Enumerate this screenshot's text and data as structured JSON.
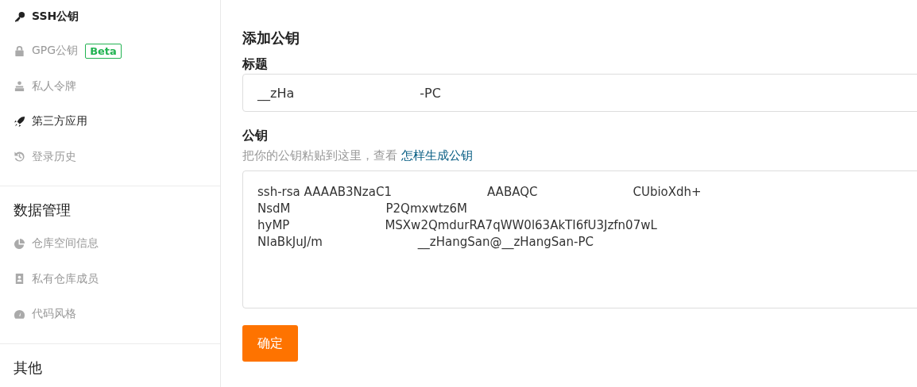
{
  "sidebar": {
    "groups": [
      {
        "items": [
          {
            "label": "SSH公钥",
            "kind": "key",
            "selected": true,
            "highlighted": false
          },
          {
            "label": "GPG公钥",
            "kind": "lock",
            "selected": false,
            "highlighted": false,
            "badge": "Beta"
          },
          {
            "label": "私人令牌",
            "kind": "token",
            "selected": false,
            "highlighted": false
          },
          {
            "label": "第三方应用",
            "kind": "rocket",
            "selected": false,
            "highlighted": true
          },
          {
            "label": "登录历史",
            "kind": "history",
            "selected": false,
            "highlighted": false
          }
        ]
      },
      {
        "heading": "数据管理",
        "items": [
          {
            "label": "仓库空间信息",
            "kind": "pie",
            "selected": false,
            "highlighted": false
          },
          {
            "label": "私有仓库成员",
            "kind": "contact",
            "selected": false,
            "highlighted": false
          },
          {
            "label": "代码风格",
            "kind": "gauge",
            "selected": false,
            "highlighted": false
          }
        ]
      },
      {
        "heading": "其他"
      }
    ]
  },
  "form": {
    "title": "添加公钥",
    "title_field": {
      "label": "标题",
      "value_parts": [
        "__zHa",
        "-PC"
      ]
    },
    "key_field": {
      "label": "公钥",
      "hint": "把你的公钥粘贴到这里，查看",
      "hint_link": "怎样生成公钥",
      "lines": [
        [
          "ssh-rsa AAAAB3NzaC1",
          "AABAQC",
          "CUbioXdh+"
        ],
        [
          "NsdM",
          "P2Qmxwtz6M"
        ],
        [
          "hyMP",
          "MSXw2QmdurRA7qWW0l63AkTI6fU3Jzfn07wL"
        ],
        [
          "NIaBkJuJ/m",
          "__zHangSan@__zHangSan-PC"
        ]
      ]
    },
    "submit": "确定"
  }
}
